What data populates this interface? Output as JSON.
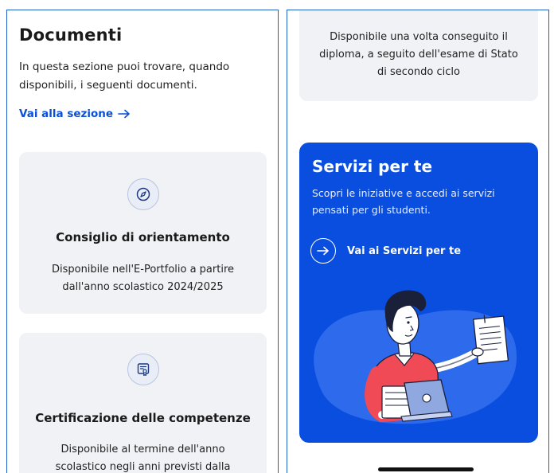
{
  "documents": {
    "title": "Documenti",
    "intro": "In questa sezione puoi trovare, quando disponibili, i seguenti documenti.",
    "section_link": "Vai alla sezione",
    "cards": [
      {
        "icon": "compass-icon",
        "title": "Consiglio di orientamento",
        "description": "Disponibile nell'E-Portfolio a partire dall'anno scolastico 2024/2025"
      },
      {
        "icon": "certificate-icon",
        "title": "Certificazione delle competenze",
        "description": "Disponibile al termine dell'anno scolastico negli anni previsti dalla"
      }
    ]
  },
  "diploma_card": {
    "description": "Disponibile una volta conseguito il diploma, a seguito dell'esame di Stato di secondo ciclo"
  },
  "services": {
    "title": "Servizi per te",
    "description": "Scopri le iniziative e accedi ai servizi pensati per gli studenti.",
    "link_label": "Vai ai Servizi per te",
    "illustration": "student-with-laptop-illustration"
  },
  "colors": {
    "accent": "#0a4fd6",
    "services_bg": "#0a4ee0",
    "card_bg": "#f1f2f5",
    "panel_border": "#1f5fc9"
  }
}
